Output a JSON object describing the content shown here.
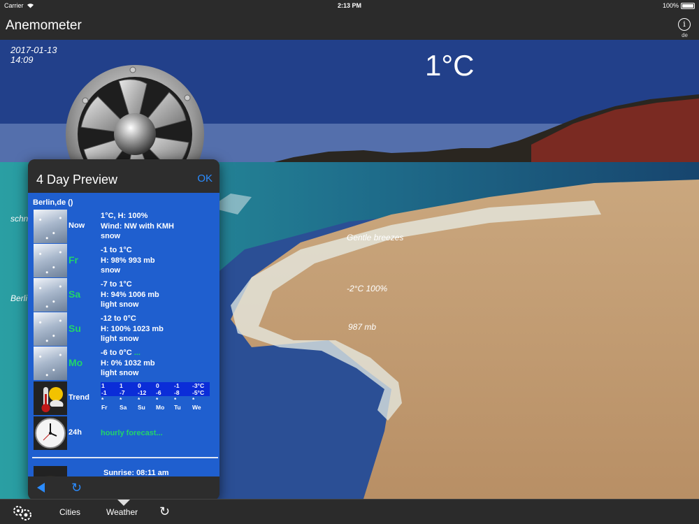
{
  "status": {
    "carrier": "Carrier",
    "time": "2:13 PM",
    "battery": "100%"
  },
  "nav": {
    "title": "Anemometer",
    "info_icon": "info-icon",
    "lang": "de"
  },
  "overlay": {
    "date": "2017-01-13",
    "time": "14:09",
    "temperature": "1°C",
    "left_partial_1": "schn",
    "left_partial_2": "Berli",
    "wind_text": "Gentle breezes",
    "temp_humidity": "-2°C 100%",
    "pressure": "987 mb"
  },
  "popover": {
    "title": "4 Day Preview",
    "ok_label": "OK",
    "city": "Berlin,de ()",
    "rows": [
      {
        "label": "Now",
        "line1": "1°C, H: 100%",
        "line2": "Wind: NW with KMH",
        "line3": "snow"
      },
      {
        "label": "Fr",
        "line1": "-1 to 1°C",
        "line2": "H: 98% 993 mb",
        "line3": "snow"
      },
      {
        "label": "Sa",
        "line1": "-7 to 1°C",
        "line2": "H: 94% 1006 mb",
        "line3": "light snow"
      },
      {
        "label": "Su",
        "line1": "-12 to 0°C",
        "line2": "H: 100% 1023 mb",
        "line3": "light snow"
      },
      {
        "label": "Mo",
        "line1": "-6 to 0°C",
        "line1_extra": "...",
        "line2": "H: 0% 1032 mb",
        "line3": "light snow"
      }
    ],
    "trend": {
      "label": "Trend",
      "highs": [
        "1",
        "1",
        "0",
        "0",
        "-1",
        "-3°C"
      ],
      "lows": [
        "-1",
        "-7",
        "-12",
        "-6",
        "-8",
        "-5°C"
      ],
      "marks": [
        "*",
        "*",
        "*",
        "*",
        "*",
        "*"
      ],
      "days": [
        "Fr",
        "Sa",
        "Su",
        "Mo",
        "Tu",
        "We"
      ]
    },
    "hourly": {
      "label": "24h",
      "link": "hourly forecast..."
    },
    "sunrise": "Sunrise: 08:11 am"
  },
  "tabbar": {
    "settings_icon": "gears-icon",
    "cities": "Cities",
    "weather": "Weather",
    "refresh_icon": "refresh-icon"
  },
  "colors": {
    "bar": "#2b2b2b",
    "panel": "#1f5fcf",
    "accent": "#2b8cff",
    "green": "#22d46a"
  }
}
